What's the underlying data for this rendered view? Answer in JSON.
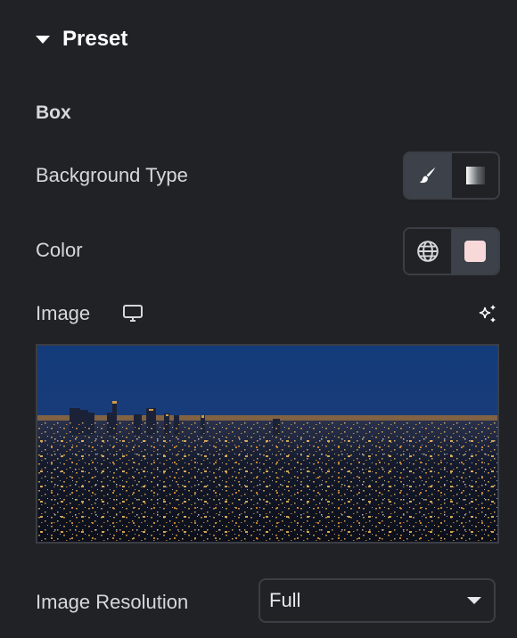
{
  "section": {
    "title": "Preset",
    "expanded": true
  },
  "group": {
    "title": "Box"
  },
  "background_type": {
    "label": "Background Type",
    "options": [
      {
        "name": "classic",
        "icon": "paintbrush-icon",
        "active": true
      },
      {
        "name": "gradient",
        "icon": "gradient-icon",
        "active": false
      }
    ]
  },
  "color": {
    "label": "Color",
    "global_icon": "globe-icon",
    "value": "#f8d9da"
  },
  "image": {
    "label": "Image",
    "device_icon": "desktop-icon",
    "ai_icon": "sparkle-icon",
    "preview_description": "City skyline at night"
  },
  "image_resolution": {
    "label": "Image Resolution",
    "value": "Full"
  },
  "colors": {
    "background": "#212226",
    "border": "#3b3e44",
    "active_segment": "#3d4149",
    "text": "#d5d8dc"
  }
}
